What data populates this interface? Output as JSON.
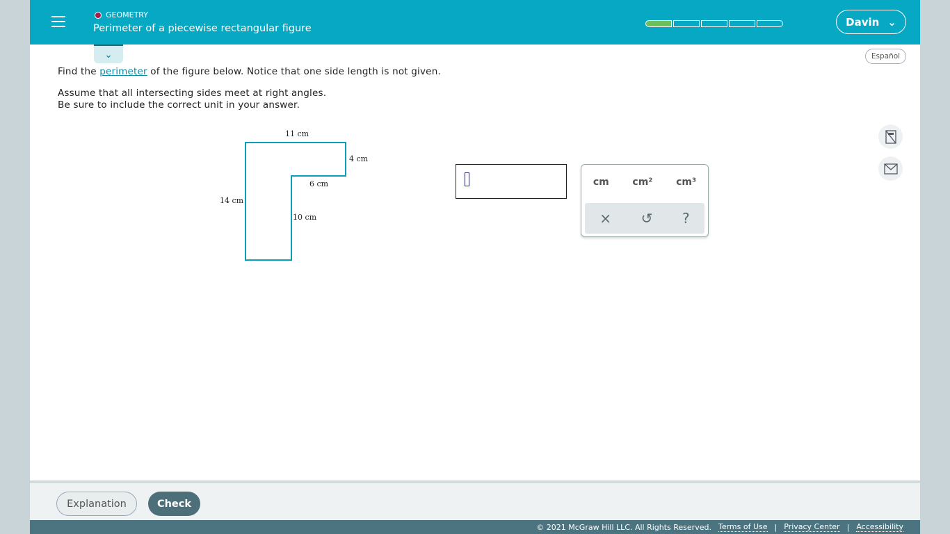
{
  "header": {
    "category": "GEOMETRY",
    "title": "Perimeter of a piecewise rectangular figure",
    "progress": {
      "completed": 1,
      "total": 5
    },
    "user": "Davin"
  },
  "language_button": "Español",
  "question": {
    "line1_pre": "Find the ",
    "line1_link": "perimeter",
    "line1_post": " of the figure below. Notice that one side length is not given.",
    "line2": "Assume that all intersecting sides meet at right angles.",
    "line3": "Be sure to include the correct unit in your answer."
  },
  "figure": {
    "top": "11 cm",
    "right": "4 cm",
    "inner_horizontal": "6 cm",
    "left": "14 cm",
    "inner_vertical": "10 cm"
  },
  "answer": {
    "value": ""
  },
  "keypad": {
    "units": [
      "cm",
      "cm²",
      "cm³"
    ],
    "clear": "×",
    "undo": "↺",
    "help": "?"
  },
  "buttons": {
    "explanation": "Explanation",
    "check": "Check"
  },
  "footer": {
    "copyright": "© 2021 McGraw Hill LLC. All Rights Reserved.",
    "terms": "Terms of Use",
    "privacy": "Privacy Center",
    "accessibility": "Accessibility",
    "sep": "|"
  }
}
